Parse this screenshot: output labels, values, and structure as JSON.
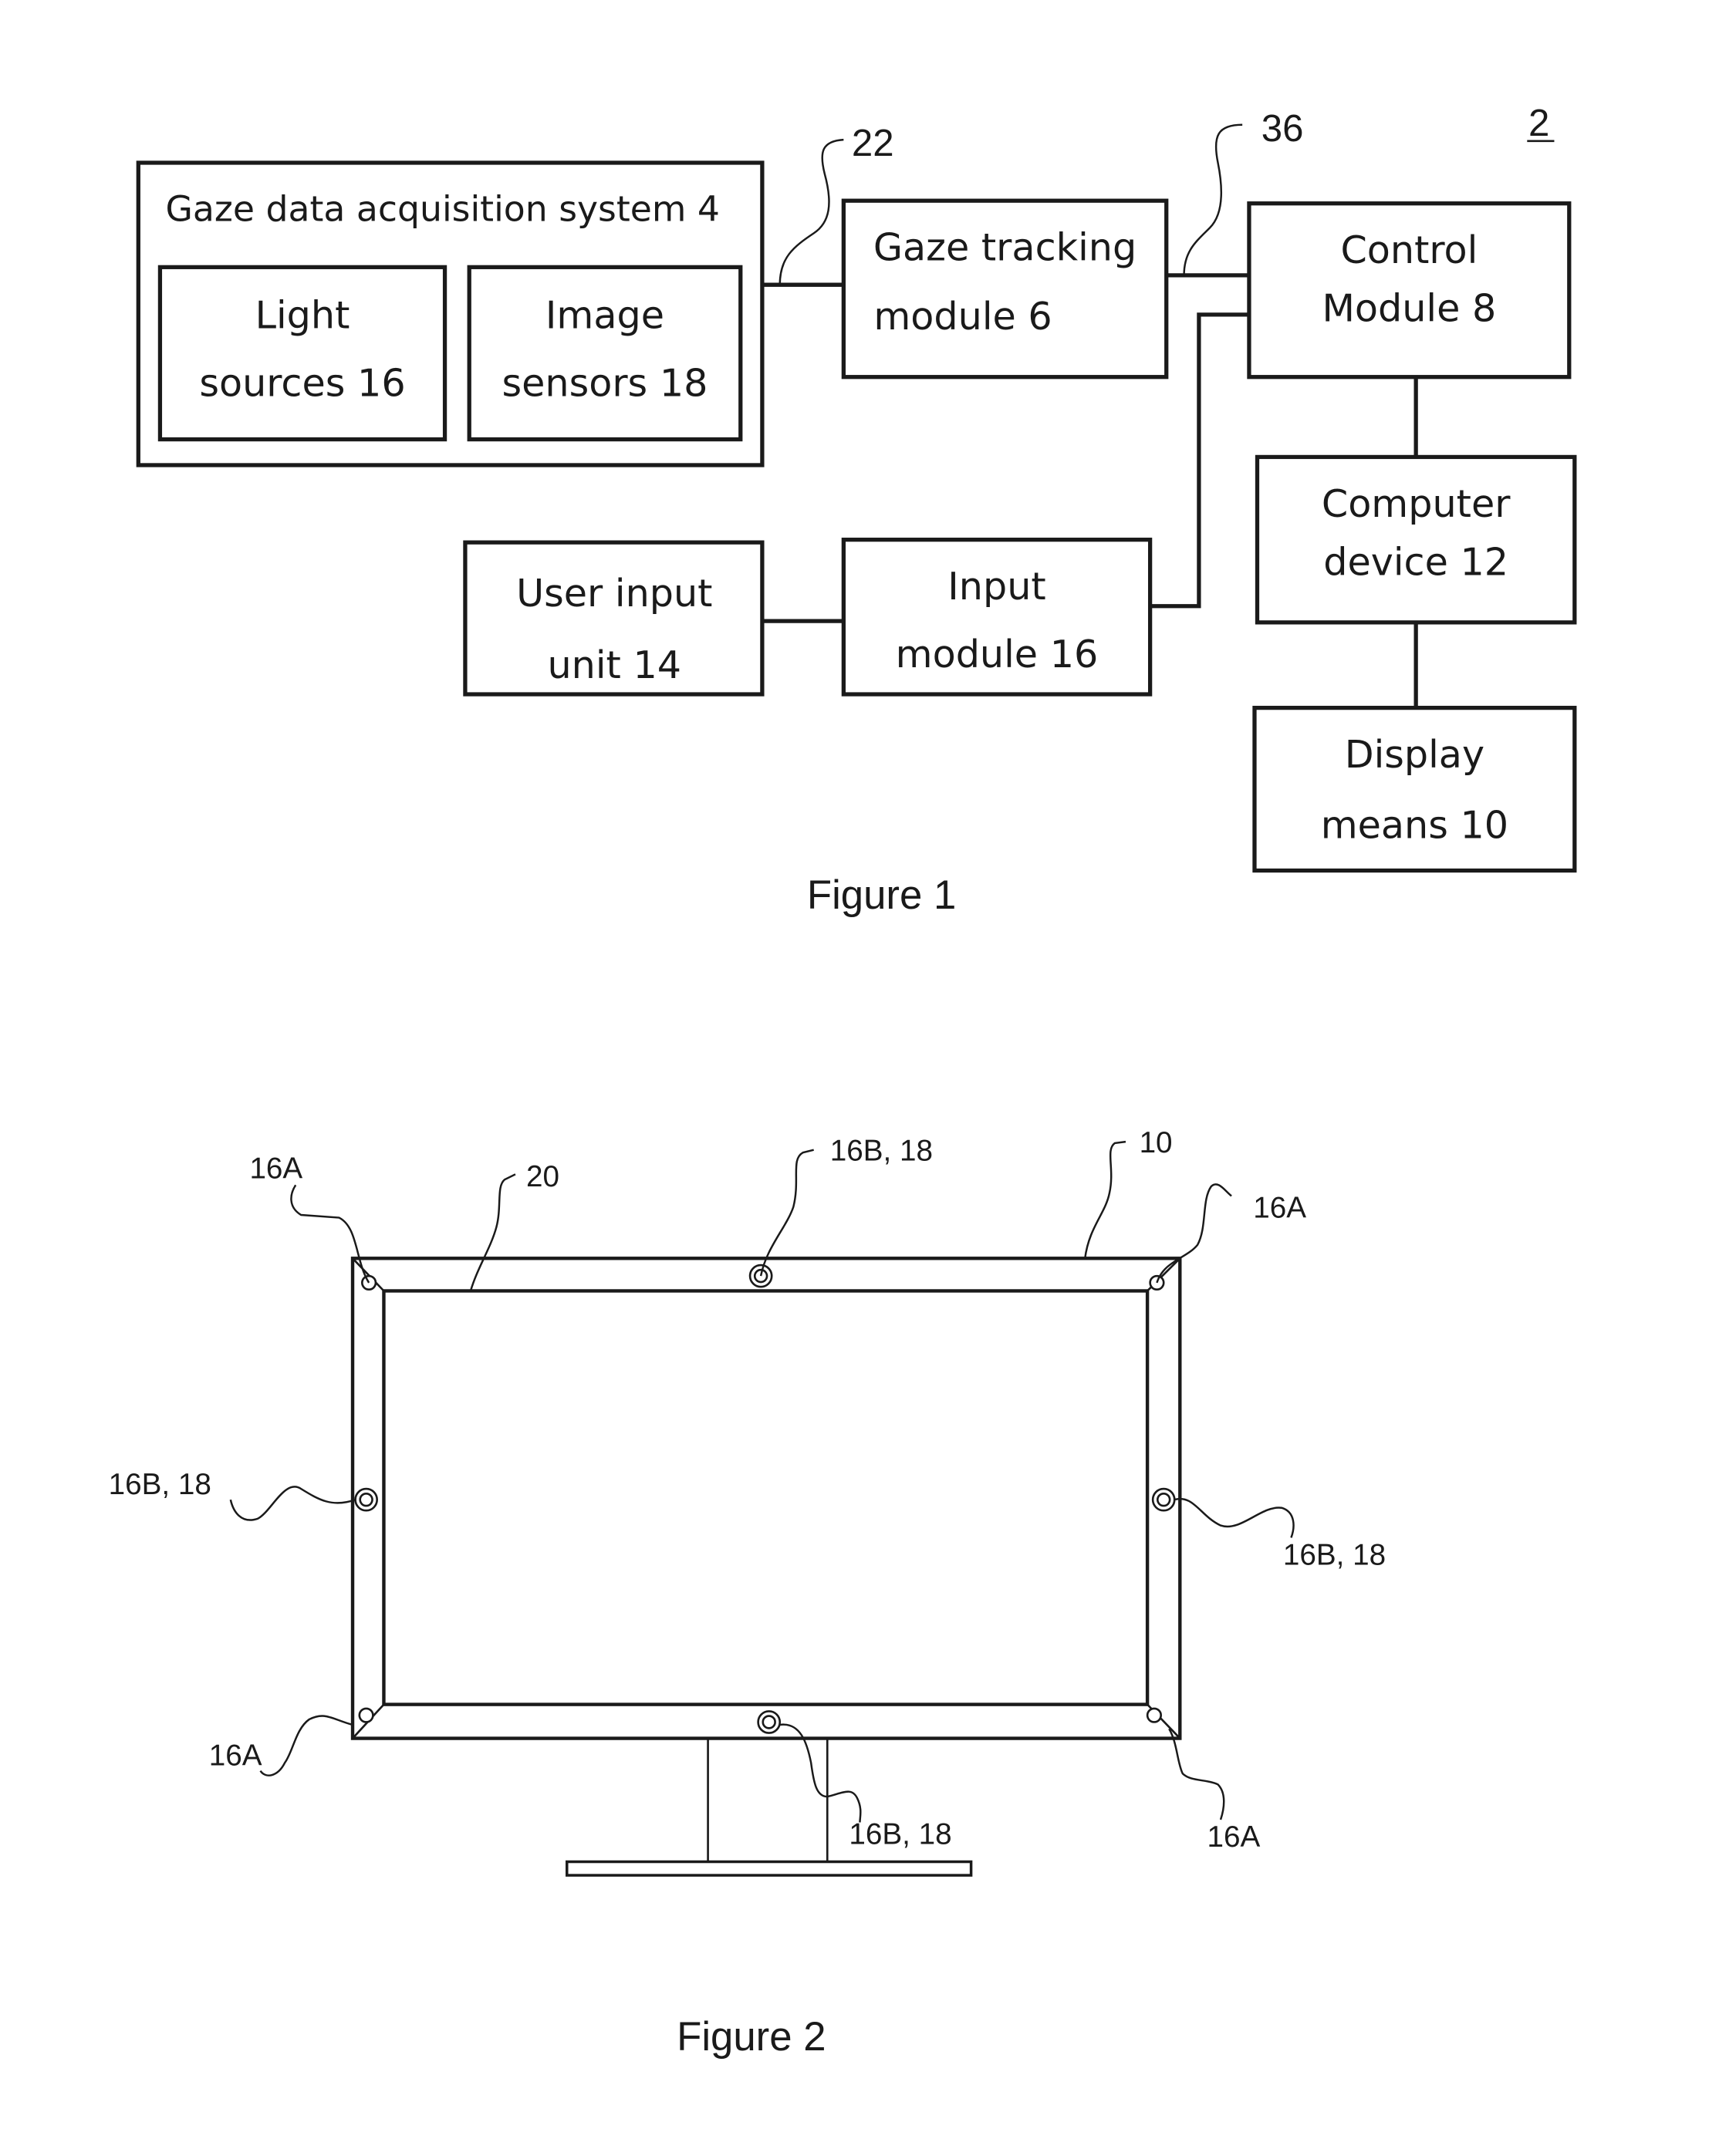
{
  "figure1": {
    "caption": "Figure 1",
    "system_ref": "2",
    "blocks": {
      "gaze_acquisition": "Gaze data acquisition system 4",
      "light_sources": [
        "Light",
        "sources 16"
      ],
      "image_sensors": [
        "Image",
        "sensors 18"
      ],
      "gaze_tracking": [
        "Gaze tracking",
        "module 6"
      ],
      "control_module": [
        "Control",
        "Module 8"
      ],
      "computer_device": [
        "Computer",
        "device 12"
      ],
      "display_means": [
        "Display",
        "means 10"
      ],
      "user_input_unit": [
        "User input",
        "unit 14"
      ],
      "input_module": [
        "Input",
        "module 16"
      ]
    },
    "refs": {
      "link_22": "22",
      "link_36": "36"
    }
  },
  "figure2": {
    "caption": "Figure 2",
    "labels": {
      "corner_top_left": "16A",
      "bezel": "20",
      "top_center": "16B, 18",
      "display": "10",
      "corner_top_right": "16A",
      "left_middle": "16B, 18",
      "right_middle": "16B, 18",
      "corner_bottom_left": "16A",
      "bottom_center": "16B, 18",
      "corner_bottom_right": "16A"
    }
  }
}
